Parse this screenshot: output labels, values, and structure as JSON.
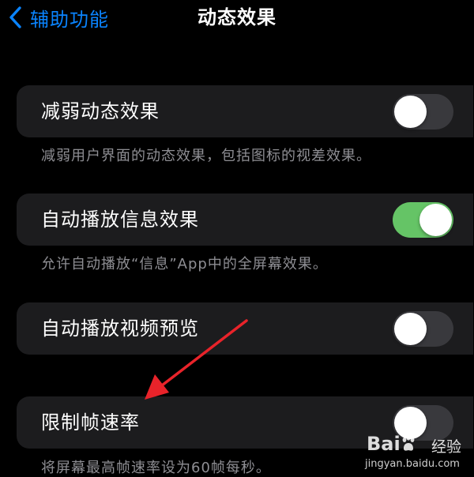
{
  "nav": {
    "back_label": "辅助功能",
    "title": "动态效果"
  },
  "settings": [
    {
      "label": "减弱动态效果",
      "on": false,
      "footer": "减弱用户界面的动态效果，包括图标的视差效果。"
    },
    {
      "label": "自动播放信息效果",
      "on": true,
      "footer": "允许自动播放“信息”App中的全屏幕效果。"
    },
    {
      "label": "自动播放视频预览",
      "on": false
    },
    {
      "label": "限制帧速率",
      "on": false,
      "footer": "将屏幕最高帧速率设为60帧每秒。"
    }
  ],
  "watermark": {
    "logo_left": "Bai",
    "logo_right": "",
    "brand": "经验",
    "url": "jingyan.baidu.com"
  },
  "colors": {
    "background": "#000000",
    "cell": "#1c1c1e",
    "accent": "#0a84ff",
    "toggle_on": "#65c466",
    "toggle_off": "#39393d",
    "annotation_arrow": "#e8232a"
  },
  "icons": {
    "back": "chevron-left-icon",
    "annotation": "red-arrow"
  }
}
